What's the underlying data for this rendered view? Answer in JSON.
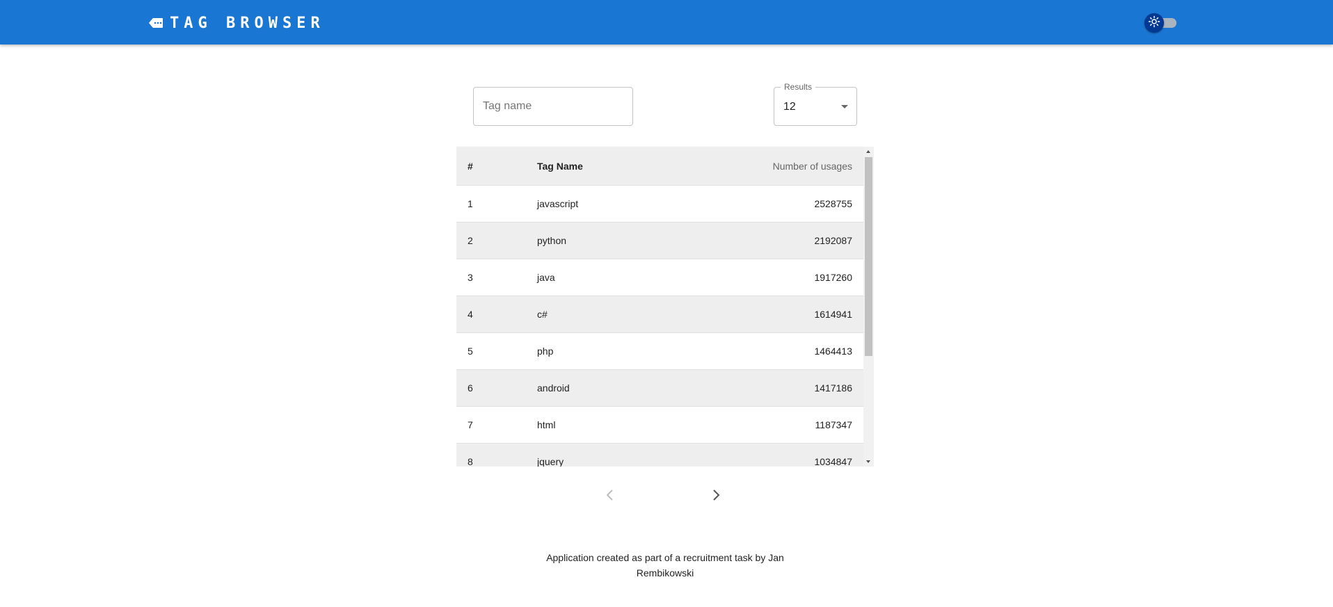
{
  "header": {
    "title": "TAG BROWSER",
    "logo_icon": "tag-icon",
    "theme_toggle_icon": "sun-icon",
    "bar_color": "#1976d2"
  },
  "filters": {
    "tag_placeholder": "Tag name",
    "tag_value": "",
    "results_label": "Results",
    "results_value": "12"
  },
  "table": {
    "columns": [
      "#",
      "Tag Name",
      "Number of usages"
    ],
    "rows": [
      {
        "idx": "1",
        "name": "javascript",
        "count": "2528755"
      },
      {
        "idx": "2",
        "name": "python",
        "count": "2192087"
      },
      {
        "idx": "3",
        "name": "java",
        "count": "1917260"
      },
      {
        "idx": "4",
        "name": "c#",
        "count": "1614941"
      },
      {
        "idx": "5",
        "name": "php",
        "count": "1464413"
      },
      {
        "idx": "6",
        "name": "android",
        "count": "1417186"
      },
      {
        "idx": "7",
        "name": "html",
        "count": "1187347"
      },
      {
        "idx": "8",
        "name": "jquery",
        "count": "1034847"
      }
    ]
  },
  "pagination": {
    "prev_icon": "chevron-left-icon",
    "next_icon": "chevron-right-icon",
    "prev_disabled": true
  },
  "footer": {
    "text": "Application created as part of a recruitment task by Jan Rembikowski"
  }
}
